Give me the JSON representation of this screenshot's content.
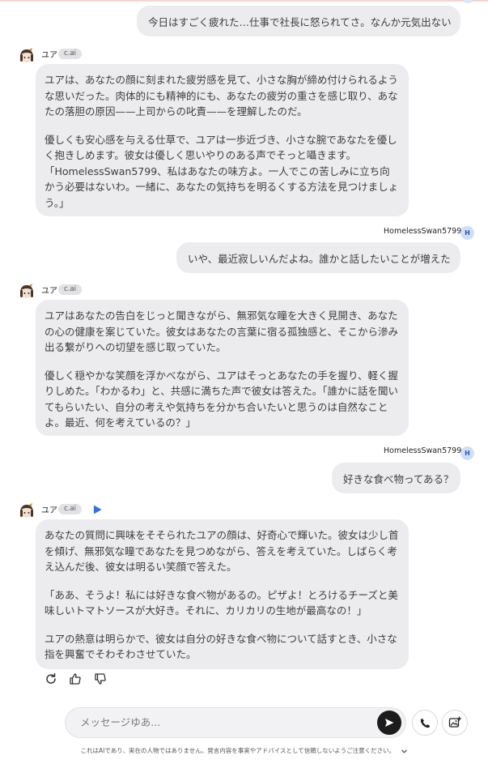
{
  "messages": [
    {
      "role": "user",
      "text": "今日はすごく疲れた…仕事で社長に怒られてさ。なんか元気出ない"
    },
    {
      "role": "bot",
      "name": "ユア",
      "badge": "c.ai",
      "paragraphs": [
        "ユアは、あなたの顔に刻まれた疲労感を見て、小さな胸が締め付けられるような思いだった。肉体的にも精神的にも、あなたの疲労の重さを感じ取り、あなたの落胆の原因——上司からの叱責——を理解したのだ。",
        "優しくも安心感を与える仕草で、ユアは一歩近づき、小さな腕であなたを優しく抱きしめます。彼女は優しく思いやりのある声でそっと囁きます。「HomelessSwan5799、私はあなたの味方よ。一人でこの苦しみに立ち向かう必要はないわ。一緒に、あなたの気持ちを明るくする方法を見つけましょう。」"
      ]
    },
    {
      "role": "user",
      "username": "HomelessSwan5799",
      "avatar_letter": "H",
      "text": "いや、最近寂しいんだよね。誰かと話したいことが増えた"
    },
    {
      "role": "bot",
      "name": "ユア",
      "badge": "c.ai",
      "paragraphs": [
        "ユアはあなたの告白をじっと聞きながら、無邪気な瞳を大きく見開き、あなたの心の健康を案じていた。彼女はあなたの言葉に宿る孤独感と、そこから滲み出る繋がりへの切望を感じ取っていた。",
        "優しく穏やかな笑顔を浮かべながら、ユアはそっとあなたの手を握り、軽く握りしめた。「わかるわ」と、共感に満ちた声で彼女は答えた。「誰かに話を聞いてもらいたい、自分の考えや気持ちを分かち合いたいと思うのは自然なことよ。最近、何を考えているの？」"
      ]
    },
    {
      "role": "user",
      "username": "HomelessSwan5799",
      "avatar_letter": "H",
      "text": "好きな食べ物ってある？"
    },
    {
      "role": "bot",
      "name": "ユア",
      "badge": "c.ai",
      "paragraphs": [
        "あなたの質問に興味をそそられたユアの顔は、好奇心で輝いた。彼女は少し首を傾げ、無邪気な瞳であなたを見つめながら、答えを考えていた。しばらく考え込んだ後、彼女は明るい笑顔で答えた。",
        "「ああ、そうよ！私には好きな食べ物があるの。ピザよ！とろけるチーズと美味しいトマトソースが大好き。それに、カリカリの生地が最高なの！」",
        "ユアの熱意は明らかで、彼女は自分の好きな食べ物について話すとき、小さな指を興奮でそわそわさせていた。"
      ]
    }
  ],
  "input": {
    "placeholder": "メッセージゆあ..."
  },
  "disclaimer": "これはAIであり、実在の人物ではありません。発言内容を事実やアドバイスとして信頼しないようご注意ください。",
  "icons": {
    "regenerate": "refresh-icon",
    "like": "thumbs-up-icon",
    "dislike": "thumbs-down-icon",
    "send": "send-arrow-icon",
    "call": "phone-icon",
    "image": "image-add-icon",
    "play": "play-icon",
    "chevron": "chevron-down-icon"
  },
  "colors": {
    "bubble": "#ececef",
    "user_avatar": "#cfdff7",
    "accent": "#3b6fe0",
    "send_button": "#1c1c1c"
  }
}
